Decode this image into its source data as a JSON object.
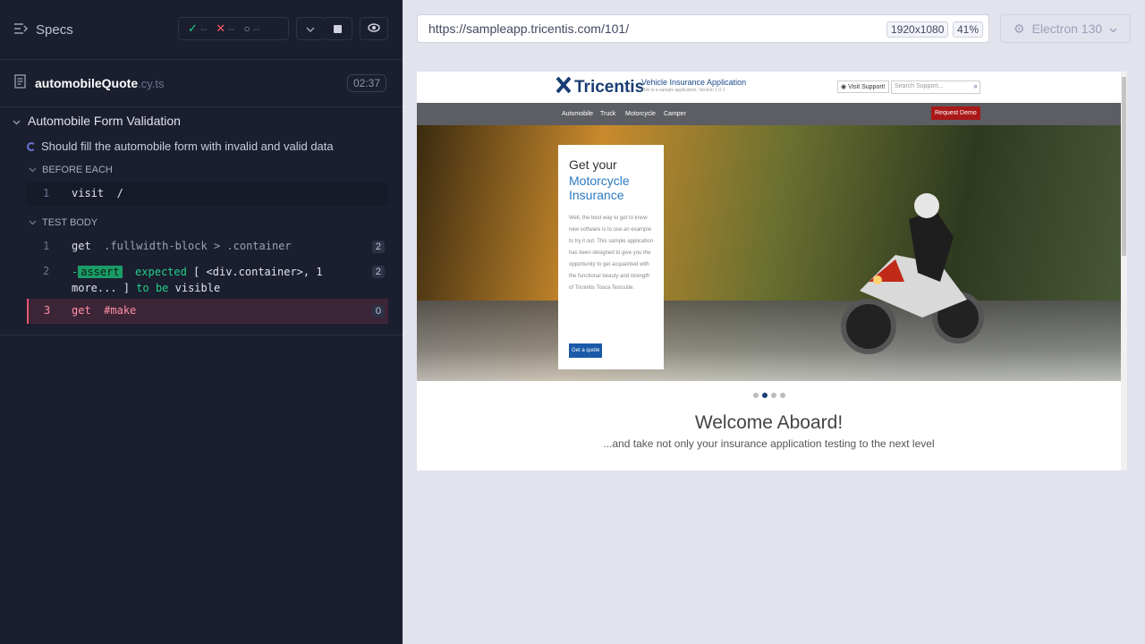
{
  "topbar": {
    "specs_label": "Specs",
    "passed": "--",
    "failed": "--",
    "pending": "--"
  },
  "file": {
    "name": "automobileQuote",
    "ext": ".cy.ts",
    "timer": "02:37"
  },
  "suite": {
    "title": "Automobile Form Validation",
    "test": "Should fill the automobile form with invalid and valid data"
  },
  "sections": {
    "before_each": "BEFORE EACH",
    "test_body": "TEST BODY"
  },
  "commands": {
    "be1_num": "1",
    "be1_name": "visit",
    "be1_arg": "/",
    "c1_num": "1",
    "c1_name": "get",
    "c1_arg": ".fullwidth-block > .container",
    "c1_count": "2",
    "c2_num": "2",
    "c2_prefix": "-",
    "c2_badge": "assert",
    "c2_text1": "expected",
    "c2_text2": "[ <div.container>, 1",
    "c2_text3": "more... ]",
    "c2_text4": "to be",
    "c2_text5": "visible",
    "c2_count": "2",
    "c3_num": "3",
    "c3_name": "get",
    "c3_arg": "#make",
    "c3_count": "0"
  },
  "browser_bar": {
    "url": "https://sampleapp.tricentis.com/101/",
    "viewport": "1920x1080",
    "zoom": "41%",
    "browser": "Electron 130"
  },
  "app": {
    "logo": "Tricentis",
    "app_title": "Vehicle Insurance Application",
    "app_sub": "This is a sample application. Version 1.0.1",
    "visit_support": "Visit Support!",
    "search_placeholder": "Search Support...",
    "nav": [
      "Automobile",
      "Truck",
      "Motorcycle",
      "Camper"
    ],
    "request_demo": "Request Demo",
    "card_title1": "Get your",
    "card_title2": "Motorcycle Insurance",
    "card_text": "Well, the best way to get to know new software is to use an example to try it out. This sample application has been designed to give you the opportunity to get acquainted with the functional beauty and strength of Tricentis Tosca Testsuite.",
    "card_button": "Get a quote",
    "welcome": "Welcome Aboard!",
    "subtitle": "...and take not only your insurance application testing to the next level"
  }
}
